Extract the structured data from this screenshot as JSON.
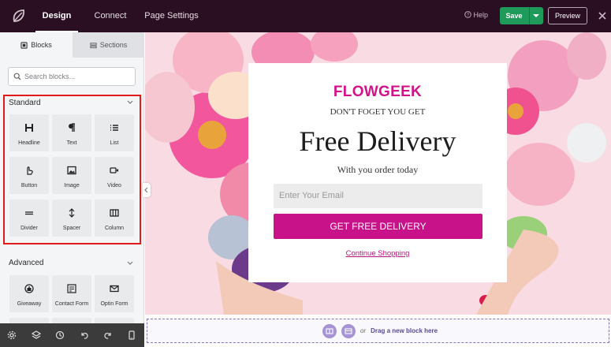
{
  "topbar": {
    "tabs": [
      {
        "label": "Design",
        "active": true
      },
      {
        "label": "Connect",
        "active": false
      },
      {
        "label": "Page Settings",
        "active": false
      }
    ],
    "help_label": "Help",
    "save_label": "Save",
    "preview_label": "Preview",
    "colors": {
      "bar": "#2a0e22",
      "save": "#1e9b5a"
    }
  },
  "sidebar": {
    "tabs": [
      {
        "label": "Blocks",
        "icon": "blocks-icon",
        "active": true
      },
      {
        "label": "Sections",
        "icon": "sections-icon",
        "active": false
      }
    ],
    "search_placeholder": "Search blocks...",
    "standard": {
      "title": "Standard",
      "blocks": [
        {
          "label": "Headline",
          "icon": "heading-icon"
        },
        {
          "label": "Text",
          "icon": "paragraph-icon"
        },
        {
          "label": "List",
          "icon": "list-icon"
        },
        {
          "label": "Button",
          "icon": "pointer-icon"
        },
        {
          "label": "Image",
          "icon": "image-icon"
        },
        {
          "label": "Video",
          "icon": "video-icon"
        },
        {
          "label": "Divider",
          "icon": "divider-icon"
        },
        {
          "label": "Spacer",
          "icon": "spacer-icon"
        },
        {
          "label": "Column",
          "icon": "column-icon"
        }
      ]
    },
    "advanced": {
      "title": "Advanced",
      "blocks": [
        {
          "label": "Giveaway",
          "icon": "giveaway-icon"
        },
        {
          "label": "Contact Form",
          "icon": "form-icon"
        },
        {
          "label": "Optin Form",
          "icon": "mail-icon"
        }
      ]
    },
    "bottom_icons": [
      "settings-icon",
      "layers-icon",
      "history-icon",
      "undo-icon",
      "redo-icon",
      "mobile-preview-icon"
    ]
  },
  "popup": {
    "brand": "FLOWGEEK",
    "subtitle": "DON'T FOGET YOU GET",
    "headline": "Free Delivery",
    "tagline": "With you order today",
    "email_placeholder": "Enter Your Email",
    "cta_label": "GET FREE DELIVERY",
    "link_label": "Continue Shopping",
    "colors": {
      "brand": "#d3118a",
      "cta": "#c8128a"
    }
  },
  "dropzone": {
    "or_label": "or",
    "drag_label": "Drag a new block here"
  }
}
